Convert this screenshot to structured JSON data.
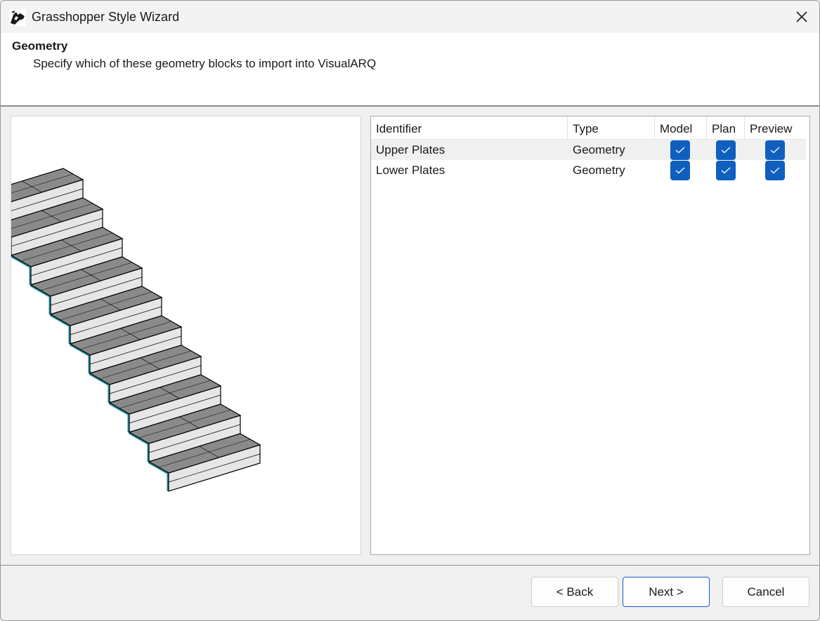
{
  "window": {
    "title": "Grasshopper Style Wizard"
  },
  "header": {
    "title": "Geometry",
    "subtitle": "Specify which of these geometry blocks to import into VisualARQ"
  },
  "grid": {
    "columns": [
      "Identifier",
      "Type",
      "Model",
      "Plan",
      "Preview"
    ],
    "rows": [
      {
        "identifier": "Upper Plates",
        "type": "Geometry",
        "model": true,
        "plan": true,
        "preview": true
      },
      {
        "identifier": "Lower Plates",
        "type": "Geometry",
        "model": true,
        "plan": true,
        "preview": true
      }
    ]
  },
  "footer": {
    "back_label": "< Back",
    "next_label": "Next >",
    "cancel_label": "Cancel"
  },
  "colors": {
    "accent": "#0f5fbe",
    "tread": "#8a8a8a",
    "riser": "#e6e6e6",
    "edge": "#1d8a9a"
  },
  "icons": [
    "rhino-app-icon",
    "close-icon",
    "check-icon",
    "stair-preview-image"
  ]
}
